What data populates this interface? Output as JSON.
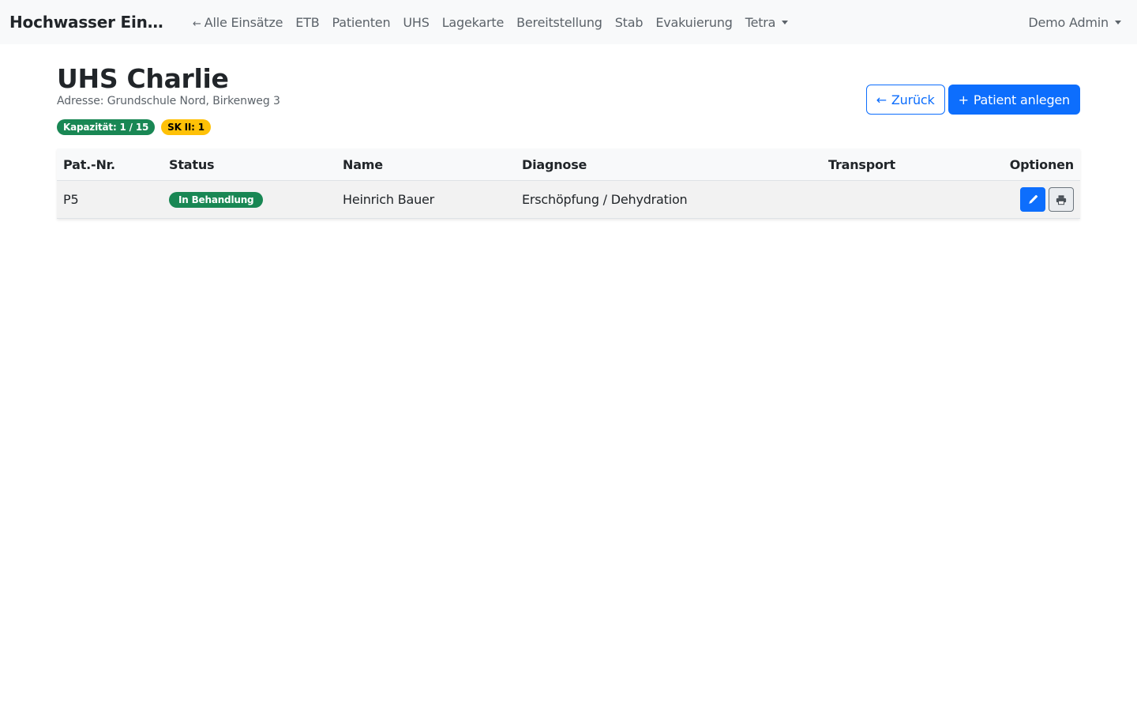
{
  "navbar": {
    "brand": "Hochwasser Einsat...",
    "links": [
      {
        "label": "Alle Einsätze",
        "arrow": "←"
      },
      {
        "label": "ETB"
      },
      {
        "label": "Patienten"
      },
      {
        "label": "UHS"
      },
      {
        "label": "Lagekarte"
      },
      {
        "label": "Bereitstellung"
      },
      {
        "label": "Stab"
      },
      {
        "label": "Evakuierung"
      },
      {
        "label": "Tetra"
      }
    ],
    "user": "Demo Admin"
  },
  "page": {
    "title": "UHS Charlie",
    "address": "Adresse: Grundschule Nord, Birkenweg 3",
    "badges": {
      "capacity": "Kapazität: 1 / 15",
      "category": "SK II: 1"
    },
    "buttons": {
      "back": "Zurück",
      "back_icon": "←",
      "add": "Patient anlegen",
      "add_icon": "+"
    }
  },
  "table": {
    "headers": {
      "number": "Pat.-Nr.",
      "status": "Status",
      "name": "Name",
      "diagnosis": "Diagnose",
      "transport": "Transport",
      "options": "Optionen"
    },
    "rows": [
      {
        "number": "P5",
        "status": "In Behandlung",
        "name": "Heinrich Bauer",
        "diagnosis": "Erschöpfung / Dehydration",
        "transport": ""
      }
    ]
  },
  "colors": {
    "primary": "#0d6efd",
    "success": "#198754",
    "warning": "#ffc107",
    "navbar_bg": "#f8f9fa"
  },
  "icons": {
    "edit": "pencil-icon",
    "print": "printer-icon"
  }
}
